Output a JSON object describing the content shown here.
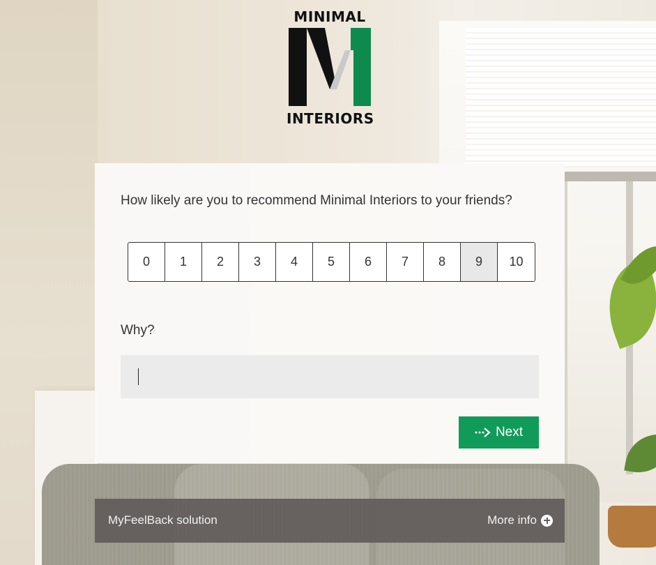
{
  "brand": {
    "logo_top": "MINIMAL",
    "logo_bottom": "INTERIORS",
    "colors": {
      "green": "#0f8a4e",
      "black": "#111111"
    }
  },
  "survey": {
    "question": "How likely are you to recommend Minimal Interiors to your friends?",
    "scale": [
      "0",
      "1",
      "2",
      "3",
      "4",
      "5",
      "6",
      "7",
      "8",
      "9",
      "10"
    ],
    "selected": "9",
    "why_label": "Why?",
    "why_value": "",
    "next_label": "Next",
    "next_icon": "dotted-arrow-right-icon",
    "accent": "#119b5a"
  },
  "footer": {
    "brand_text": "MyFeelBack solution",
    "more_info_label": "More info",
    "more_info_icon": "plus-circle-icon"
  }
}
